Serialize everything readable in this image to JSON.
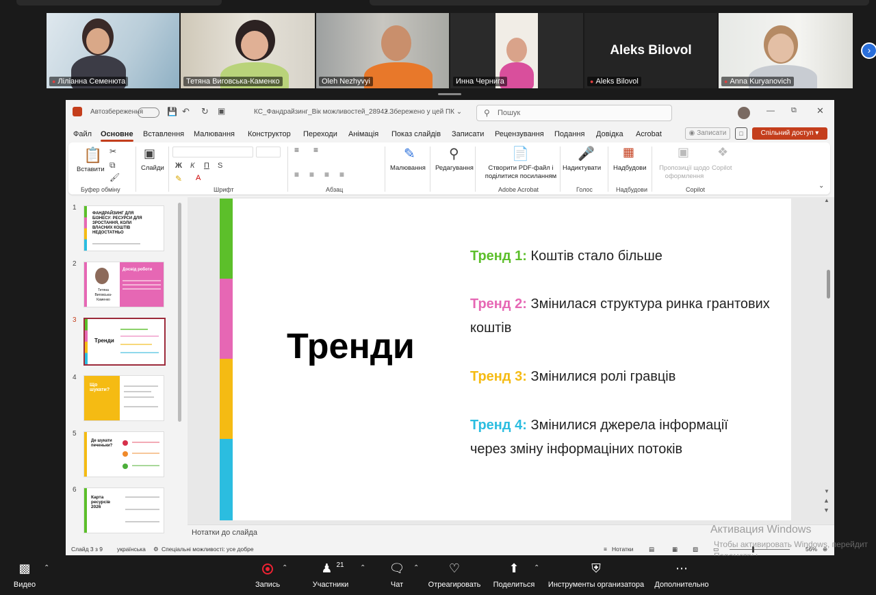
{
  "participants": [
    {
      "name": "Ліліанна Семенюта",
      "muted": true
    },
    {
      "name": "Тетяна Виговська-Каменко",
      "muted": false,
      "active": true
    },
    {
      "name": "Oleh Nezhyvyi",
      "muted": false
    },
    {
      "name": "Инна Чернига",
      "muted": false
    },
    {
      "name": "Aleks Bilovol",
      "muted": true,
      "video_off": true,
      "big_name": "Aleks Bilovol"
    },
    {
      "name": "Anna Kuryanovich",
      "muted": true
    }
  ],
  "powerpoint": {
    "autosave": "Автозбереження",
    "filename": "КС_Фандрайзинг_Вік можливостей_28942...",
    "saved": "• Збережено у цей ПК ⌄",
    "search_placeholder": "Пошук",
    "tabs": [
      "Файл",
      "Основне",
      "Вставлення",
      "Малювання",
      "Конструктор",
      "Переходи",
      "Анімація",
      "Показ слайдів",
      "Записати",
      "Рецензування",
      "Подання",
      "Довідка",
      "Acrobat"
    ],
    "record_btn": "Записати",
    "share_btn": "Спільний доступ",
    "ribbon": {
      "paste": "Вставити",
      "clipboard": "Буфер обміну",
      "slides": "Слайди",
      "font": "Шрифт",
      "paragraph": "Абзац",
      "drawing": "Малювання",
      "editing": "Редагування",
      "pdf_line1": "Створити PDF-файл і",
      "pdf_line2": "поділитися посиланням",
      "adobe": "Adobe Acrobat",
      "dictate": "Надиктувати",
      "voice": "Голос",
      "addins": "Надбудови",
      "addins_group": "Надбудови",
      "suggest_line1": "Пропозиції щодо",
      "suggest_line2": "оформлення",
      "copilot": "Copilot",
      "copilot_group": "Copilot"
    },
    "thumbnails": [
      {
        "num": "1",
        "title": "ФАНДРАЙЗИНГ ДЛЯ БІЗНЕСУ: РЕСУРСИ ДЛЯ ЗРОСТАННЯ, КОЛИ ВЛАСНИХ КОШТІВ НЕДОСТАТНЬО"
      },
      {
        "num": "2",
        "title": "Досвід роботи",
        "caption": "Тетяна Виговська-Каменко"
      },
      {
        "num": "3",
        "title": "Тренди"
      },
      {
        "num": "4",
        "title": "Що шукати?"
      },
      {
        "num": "5",
        "title": "Де шукати печеньки?"
      },
      {
        "num": "6",
        "title": "Карта ресурсів 2026"
      }
    ],
    "slide": {
      "title": "Тренди",
      "trends": [
        {
          "label": "Тренд 1:",
          "text": "Коштів стало більше",
          "color": "#5cbf2a"
        },
        {
          "label": "Тренд 2:",
          "text": "Змінилася структура ринка грантових коштів",
          "color": "#e667b4"
        },
        {
          "label": "Тренд 3:",
          "text": "Змінилися ролі гравців",
          "color": "#f5bb13"
        },
        {
          "label": "Тренд 4:",
          "text": "Змінилися джерела інформації через зміну інформаціних потоків",
          "color": "#2bbde0"
        }
      ]
    },
    "notes_placeholder": "Нотатки до слайда",
    "status": {
      "slide": "Слайд 3 з 9",
      "lang": "українська",
      "accessibility": "Спеціальні можливості: усе добре",
      "notes": "Нотатки",
      "zoom": "56%"
    }
  },
  "watermark": {
    "line1": "Активация Windows",
    "line2": "Чтобы активировать Windows, перейдит",
    "line3": "Параметры"
  },
  "toolbar": {
    "video": "Видео",
    "record": "Запись",
    "participants": "Участники",
    "participants_count": "21",
    "chat": "Чат",
    "react": "Отреагировать",
    "share": "Поделиться",
    "host_tools": "Инструменты организатора",
    "more": "Дополнительно"
  },
  "colors": {
    "accent": "#c43e1c",
    "active_speaker": "#2fc27a",
    "bar_green": "#5cbf2a",
    "bar_pink": "#e667b4",
    "bar_yellow": "#f5bb13",
    "bar_blue": "#2bbde0"
  }
}
